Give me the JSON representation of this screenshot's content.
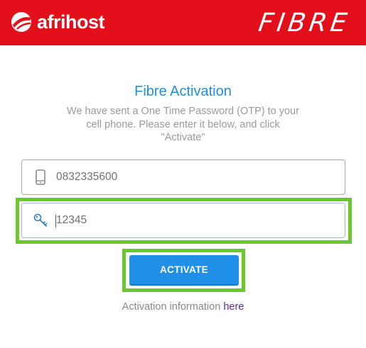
{
  "header": {
    "brand": "afrihost",
    "product": "FIBRE",
    "brand_color": "#e3101c"
  },
  "main": {
    "title": "Fibre Activation",
    "subtitle": "We have sent a One Time Password (OTP) to your cell phone. Please enter it below, and click \"Activate\"",
    "phone_field": {
      "value": "0832335600",
      "icon": "mobile-phone-icon"
    },
    "otp_field": {
      "value": "12345",
      "icon": "key-icon"
    },
    "activate_label": "ACTIVATE",
    "info_text": "Activation information",
    "info_link": "here",
    "accent_color": "#1e8fde",
    "highlight_color": "#6cc72a"
  }
}
